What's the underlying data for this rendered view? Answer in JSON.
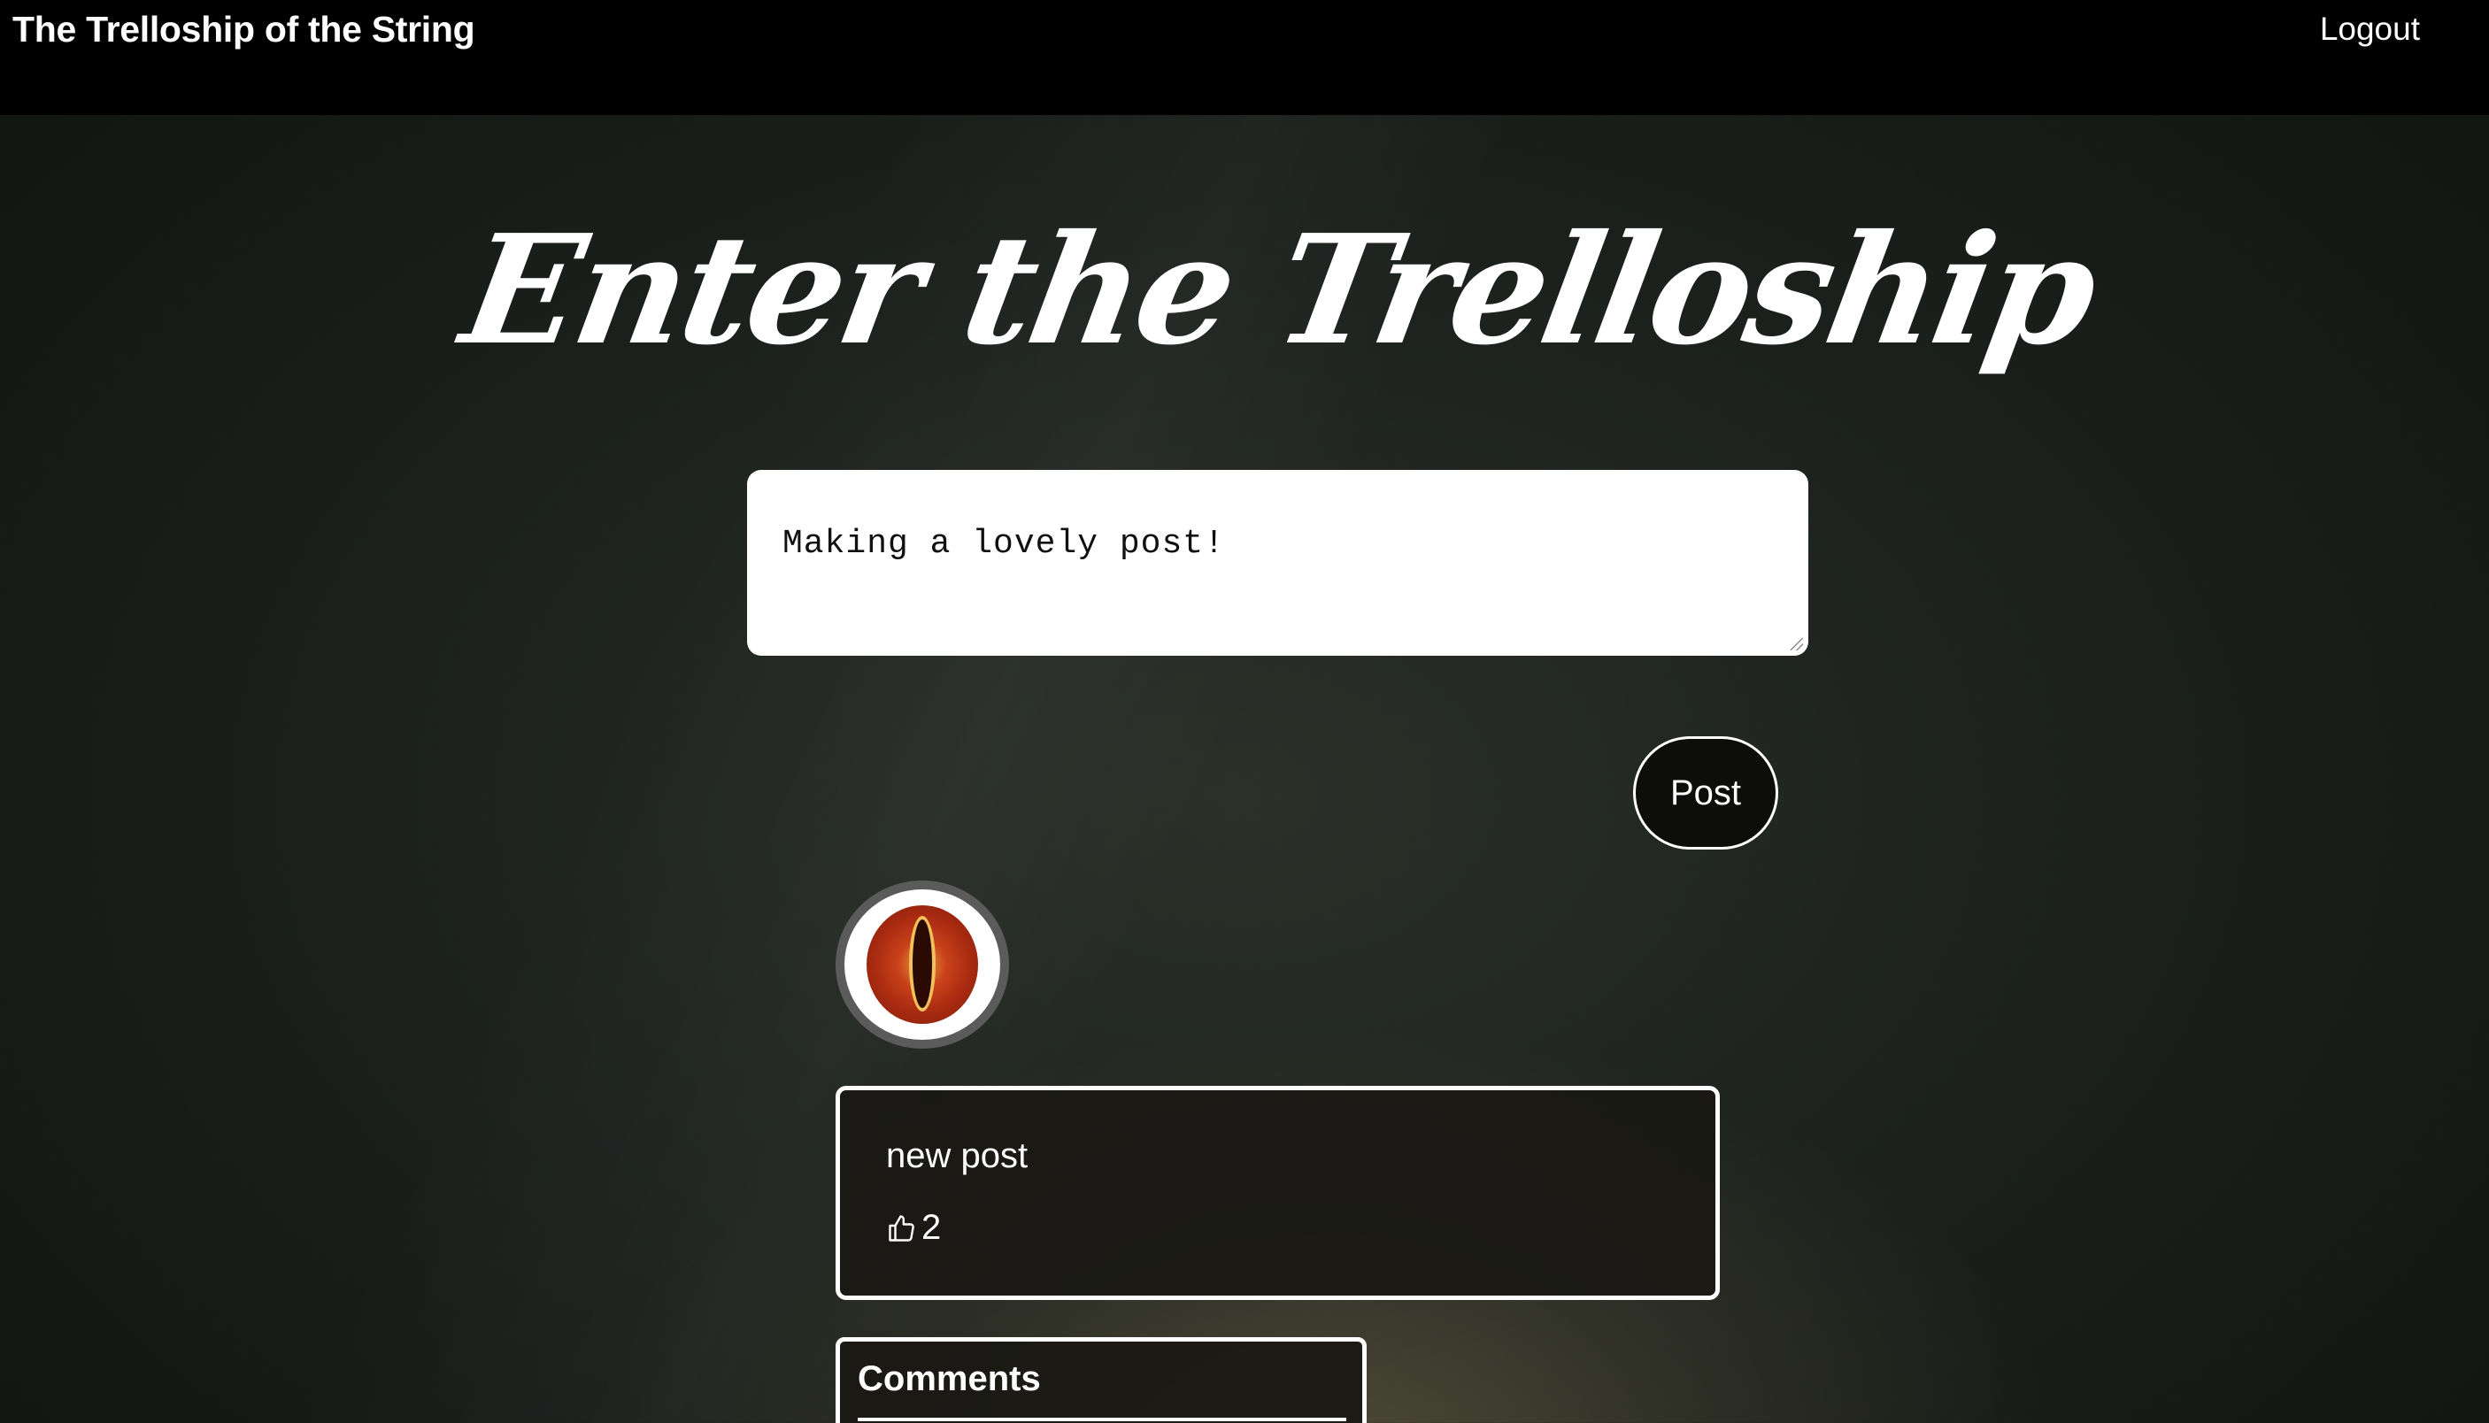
{
  "navbar": {
    "brand": "The Trelloship of the String",
    "logout_label": "Logout"
  },
  "hero": {
    "title": "Enter the Trelloship"
  },
  "composer": {
    "value": "Making a lovely post!",
    "post_label": "Post"
  },
  "post": {
    "avatar_icon": "eye-of-sauron-avatar",
    "text": "new post",
    "like_icon": "thumbs-up-icon",
    "likes": "2"
  },
  "comments": {
    "title": "Comments"
  }
}
